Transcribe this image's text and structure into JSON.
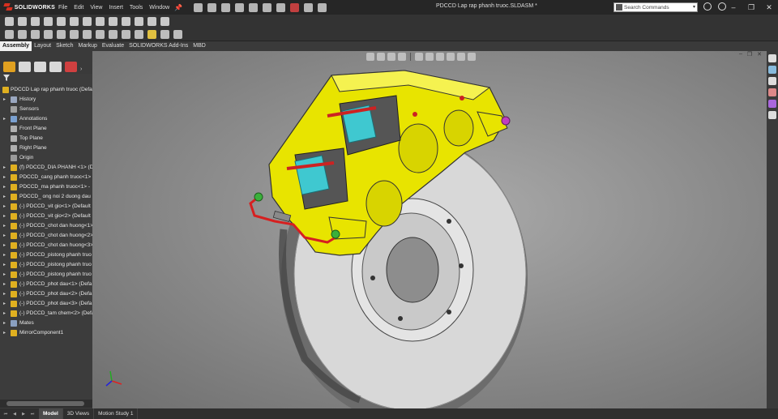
{
  "app": {
    "logo_text": "SOLIDWORKS",
    "menus": [
      "File",
      "Edit",
      "View",
      "Insert",
      "Tools",
      "Window"
    ],
    "document_title": "PDCCD Lap rap phanh truoc.SLDASM *",
    "search_placeholder": "Search Commands",
    "window_controls": [
      "–",
      "❐",
      "✕"
    ]
  },
  "command_tabs": [
    {
      "label": "Assembly",
      "active": true
    },
    {
      "label": "Layout",
      "active": false
    },
    {
      "label": "Sketch",
      "active": false
    },
    {
      "label": "Markup",
      "active": false
    },
    {
      "label": "Evaluate",
      "active": false
    },
    {
      "label": "SOLIDWORKS Add-Ins",
      "active": false
    },
    {
      "label": "MBD",
      "active": false
    }
  ],
  "feature_tree": {
    "root": "PDCCD Lap rap phanh truoc  (Defa",
    "items": [
      {
        "label": "History",
        "icon": "history-icon"
      },
      {
        "label": "Sensors",
        "icon": "sensor-icon"
      },
      {
        "label": "Annotations",
        "icon": "annotation-icon"
      },
      {
        "label": "Front Plane",
        "icon": "plane-icon"
      },
      {
        "label": "Top Plane",
        "icon": "plane-icon"
      },
      {
        "label": "Right Plane",
        "icon": "plane-icon"
      },
      {
        "label": "Origin",
        "icon": "origin-icon"
      },
      {
        "label": "(f) PDCCD_DIA PHANH <1> (D",
        "icon": "part-icon"
      },
      {
        "label": "PDCCD_cang phanh truoc<1> -",
        "icon": "part-icon"
      },
      {
        "label": "PDCCD_ma phanh truoc<1> -",
        "icon": "part-icon"
      },
      {
        "label": "PDCCD_ ong noi 2 duong dau",
        "icon": "part-icon"
      },
      {
        "label": "(-) PDCCD_vit gio<1> (Default",
        "icon": "part-icon"
      },
      {
        "label": "(-) PDCCD_vit gio<2> (Default",
        "icon": "part-icon"
      },
      {
        "label": "(-) PDCCD_chot dan huong<1>",
        "icon": "part-icon"
      },
      {
        "label": "(-) PDCCD_chot dan huong<2>",
        "icon": "part-icon"
      },
      {
        "label": "(-) PDCCD_chot dan huong<3>",
        "icon": "part-icon"
      },
      {
        "label": "(-) PDCCD_pistong phanh truo",
        "icon": "part-icon"
      },
      {
        "label": "(-) PDCCD_pistong phanh truo",
        "icon": "part-icon"
      },
      {
        "label": "(-) PDCCD_pistong phanh truo",
        "icon": "part-icon"
      },
      {
        "label": "(-) PDCCD_phot dau<1> (Defa",
        "icon": "part-icon"
      },
      {
        "label": "(-) PDCCD_phot dau<2> (Defa",
        "icon": "part-icon"
      },
      {
        "label": "(-) PDCCD_phot dau<3> (Defa",
        "icon": "part-icon"
      },
      {
        "label": "(-) PDCCD_tam chem<2> (Defa",
        "icon": "part-icon"
      },
      {
        "label": "Mates",
        "icon": "mates-icon"
      },
      {
        "label": "MirrorComponent1",
        "icon": "mirror-icon"
      }
    ]
  },
  "bottom_tabs": [
    {
      "label": "Model",
      "active": true
    },
    {
      "label": "3D Views",
      "active": false
    },
    {
      "label": "Motion Study 1",
      "active": false
    }
  ],
  "colors": {
    "caliper": "#e8e400",
    "pad_cyan": "#3fc8d0",
    "disc": "#d8d8d8",
    "brake_line": "#d62020",
    "fitting_green": "#3ab03a",
    "bleeder_purple": "#c040c0"
  }
}
